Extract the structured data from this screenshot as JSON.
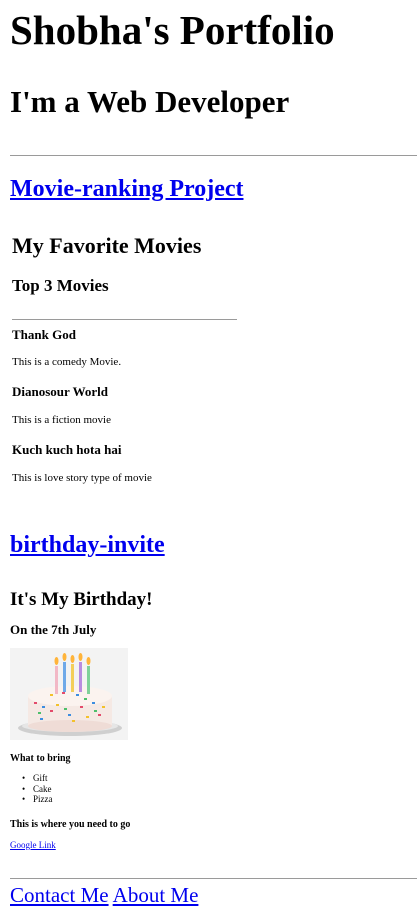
{
  "header": {
    "site_title": "Shobha's Portfolio",
    "role": "I'm a Web Developer"
  },
  "movie_project": {
    "link_label": "Movie-ranking Project",
    "heading": "My Favorite Movies",
    "subheading": "Top 3 Movies",
    "movies": [
      {
        "title": "Thank God",
        "description": "This is a comedy Movie."
      },
      {
        "title": "Dianosour World",
        "description": "This is a fiction movie"
      },
      {
        "title": "Kuch kuch hota hai",
        "description": "This is love story type of movie"
      }
    ]
  },
  "birthday": {
    "link_label": "birthday-invite",
    "heading": "It's My Birthday!",
    "date": "On the 7th July",
    "image_icon": "birthday-cake-image",
    "bring_heading": "What to bring",
    "bring_items": [
      "Gift",
      "Cake",
      "Pizza"
    ],
    "location_heading": "This is where you need to go",
    "map_link": "Google Link"
  },
  "footer": {
    "contact_label": "Contact Me",
    "about_label": "About Me"
  },
  "colors": {
    "link": "#0000ee",
    "text": "#000000",
    "rule": "#9a9a9a"
  }
}
